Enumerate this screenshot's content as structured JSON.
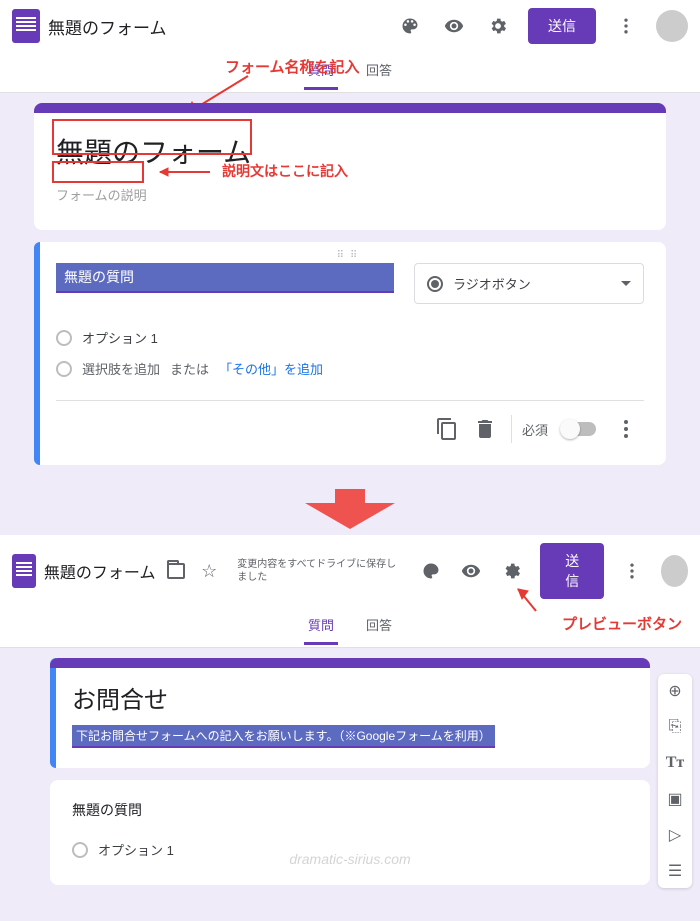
{
  "screen1": {
    "topbar": {
      "title": "無題のフォーム",
      "send": "送信"
    },
    "tabs": {
      "questions": "質問",
      "answers": "回答"
    },
    "formcard": {
      "title": "無題のフォーム",
      "desc": "フォームの説明"
    },
    "question": {
      "text": "無題の質問",
      "type": "ラジオボタン",
      "opt1": "オプション 1",
      "addopt": "選択肢を追加",
      "or": "または",
      "addother": "「その他」を追加",
      "required": "必須"
    },
    "anno": {
      "titleNote": "フォーム名称を記入",
      "descNote": "説明文はここに記入"
    }
  },
  "screen2": {
    "topbar": {
      "title": "無題のフォーム",
      "saved": "変更内容をすべてドライブに保存しました",
      "send": "送信"
    },
    "tabs": {
      "questions": "質問",
      "answers": "回答"
    },
    "formcard": {
      "title": "お問合せ",
      "desc": "下記お問合せフォームへの記入をお願いします。（※Googleフォームを利用）"
    },
    "question": {
      "text": "無題の質問",
      "opt1": "オプション 1"
    },
    "anno": {
      "preview": "プレビューボタン"
    },
    "watermark": "dramatic-sirius.com"
  }
}
